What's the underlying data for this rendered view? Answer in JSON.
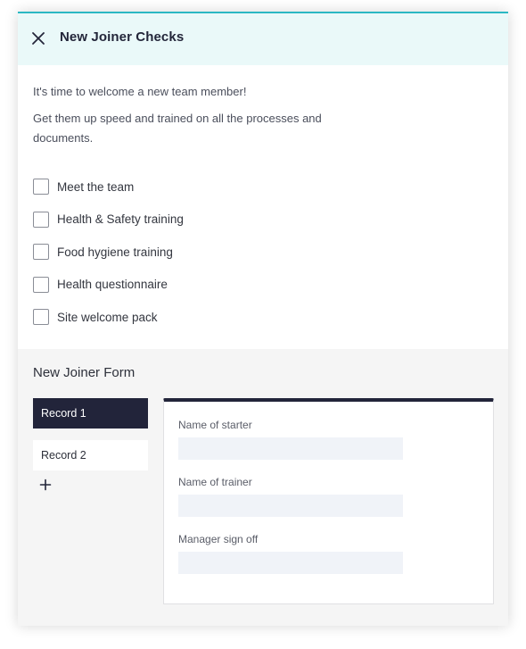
{
  "header": {
    "title": "New Joiner Checks",
    "close_icon": "close-icon",
    "accent_color": "#2bb8c3"
  },
  "intro": {
    "line1": "It's time to welcome a new team member!",
    "line2": "Get them up speed and trained on all the processes and documents."
  },
  "checklist": [
    {
      "label": "Meet the team",
      "checked": false
    },
    {
      "label": "Health & Safety training",
      "checked": false
    },
    {
      "label": "Food hygiene training",
      "checked": false
    },
    {
      "label": "Health questionnaire",
      "checked": false
    },
    {
      "label": "Site welcome pack",
      "checked": false
    }
  ],
  "form": {
    "title": "New Joiner Form",
    "records": [
      {
        "label": "Record 1",
        "active": true
      },
      {
        "label": "Record 2",
        "active": false
      }
    ],
    "add_icon": "plus-icon",
    "fields": [
      {
        "label": "Name of starter",
        "value": ""
      },
      {
        "label": "Name of trainer",
        "value": ""
      },
      {
        "label": "Manager sign off",
        "value": ""
      }
    ],
    "card_accent_color": "#22243a"
  }
}
